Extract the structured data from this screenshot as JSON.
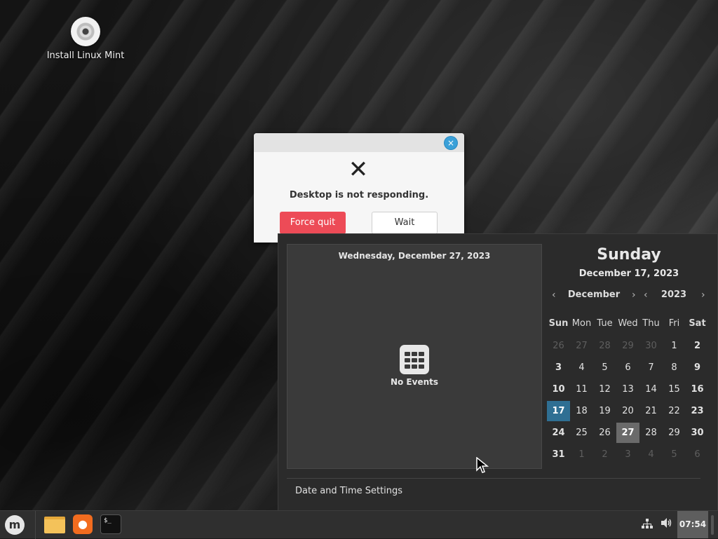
{
  "desktop": {
    "icons": [
      {
        "label": "Install Linux Mint",
        "icon": "disc-icon"
      }
    ]
  },
  "dialog": {
    "message": "Desktop is not responding.",
    "force_quit_label": "Force quit",
    "wait_label": "Wait",
    "close_icon": "×",
    "status_icon": "✕"
  },
  "calendar": {
    "events_date": "Wednesday, December 27, 2023",
    "no_events_label": "No Events",
    "day_name": "Sunday",
    "full_date": "December 17, 2023",
    "month": "December",
    "year": "2023",
    "prev_arrow": "‹",
    "next_arrow": "›",
    "weekdays": [
      "Sun",
      "Mon",
      "Tue",
      "Wed",
      "Thu",
      "Fri",
      "Sat"
    ],
    "weeks": [
      [
        "26",
        "27",
        "28",
        "29",
        "30",
        "1",
        "2"
      ],
      [
        "3",
        "4",
        "5",
        "6",
        "7",
        "8",
        "9"
      ],
      [
        "10",
        "11",
        "12",
        "13",
        "14",
        "15",
        "16"
      ],
      [
        "17",
        "18",
        "19",
        "20",
        "21",
        "22",
        "23"
      ],
      [
        "24",
        "25",
        "26",
        "27",
        "28",
        "29",
        "30"
      ],
      [
        "31",
        "1",
        "2",
        "3",
        "4",
        "5",
        "6"
      ]
    ],
    "today": "17",
    "selected": "27",
    "settings_label": "Date and Time Settings"
  },
  "taskbar": {
    "menu_icon": "mint-menu-icon",
    "launchers": [
      "files-icon",
      "firefox-icon",
      "terminal-icon"
    ],
    "terminal_glyph": "$_",
    "clock": "07:54"
  },
  "colors": {
    "accent": "#2f6f93",
    "danger": "#ed4b57",
    "close_button": "#3aa0d8",
    "panel": "#2f2f2f"
  }
}
